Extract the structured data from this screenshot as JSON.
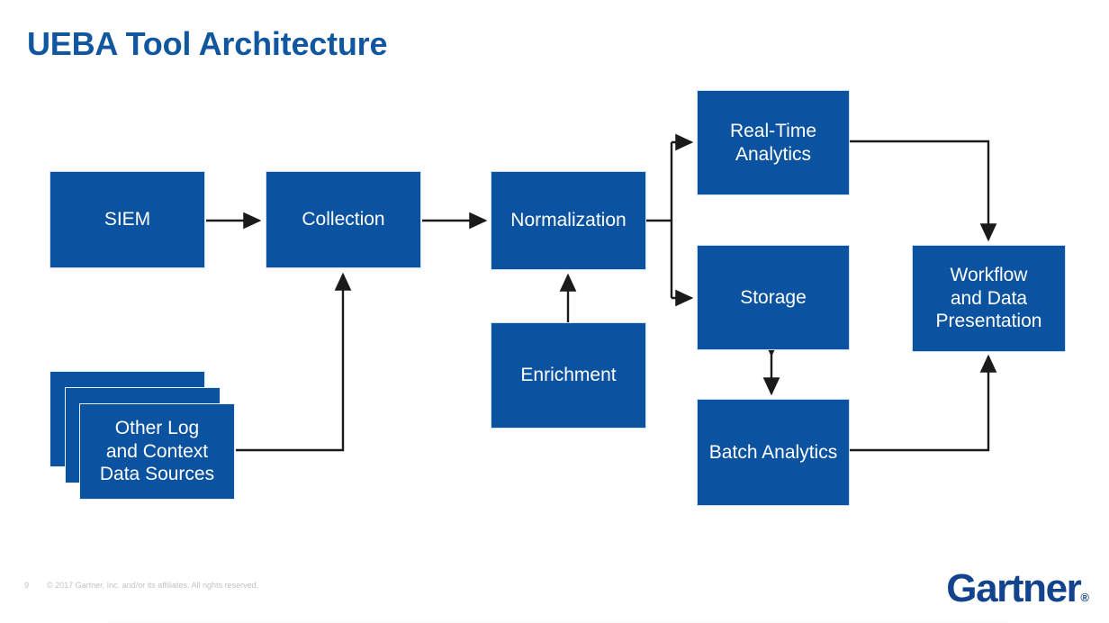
{
  "slide": {
    "title": "UEBA Tool Architecture",
    "background_color": "#ffffff",
    "title_color": "#10579f",
    "node_color": "#0b52a0",
    "node_text_color": "#ffffff",
    "connector_color": "#1a1a1a"
  },
  "nodes": {
    "siem": {
      "label": "SIEM"
    },
    "collection": {
      "label": "Collection"
    },
    "normalization": {
      "label": "Normalization"
    },
    "enrichment": {
      "label": "Enrichment"
    },
    "other_sources": {
      "label": "Other Log\nand Context\nData Sources",
      "line1": "Other Log",
      "line2": "and Context",
      "line3": "Data Sources"
    },
    "realtime": {
      "label": "Real-Time\nAnalytics",
      "line1": "Real-Time",
      "line2": "Analytics"
    },
    "storage": {
      "label": "Storage"
    },
    "batch": {
      "label": "Batch Analytics"
    },
    "workflow": {
      "label": "Workflow\nand Data\nPresentation",
      "line1": "Workflow",
      "line2": "and Data",
      "line3": "Presentation"
    }
  },
  "footer": {
    "page_number": "9",
    "copyright": "© 2017 Gartner, Inc. and/or its affiliates. All rights reserved.",
    "logo_text": "Gartner",
    "logo_mark": "®"
  }
}
